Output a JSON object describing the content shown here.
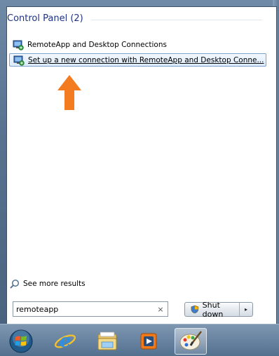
{
  "start_menu": {
    "section_title": "Control Panel (2)",
    "results": [
      {
        "label": "RemoteApp and Desktop Connections",
        "icon": "remoteapp-icon",
        "selected": false
      },
      {
        "label": "Set up a new connection with RemoteApp and Desktop Conne...",
        "icon": "remoteapp-icon",
        "selected": true
      }
    ],
    "see_more_label": "See more results",
    "search": {
      "value": "remoteapp",
      "clear_symbol": "×"
    },
    "shutdown": {
      "label": "Shut down",
      "arrow_symbol": "▸"
    }
  },
  "annotation": {
    "arrow_color": "#f47c20"
  },
  "taskbar": {
    "items": [
      {
        "icon": "windows-start-orb-icon"
      },
      {
        "icon": "internet-explorer-icon"
      },
      {
        "icon": "file-explorer-icon"
      },
      {
        "icon": "media-player-icon"
      },
      {
        "icon": "paint-icon"
      }
    ]
  },
  "colors": {
    "accent_title": "#1e3287",
    "selection_border": "#7da2ce"
  }
}
